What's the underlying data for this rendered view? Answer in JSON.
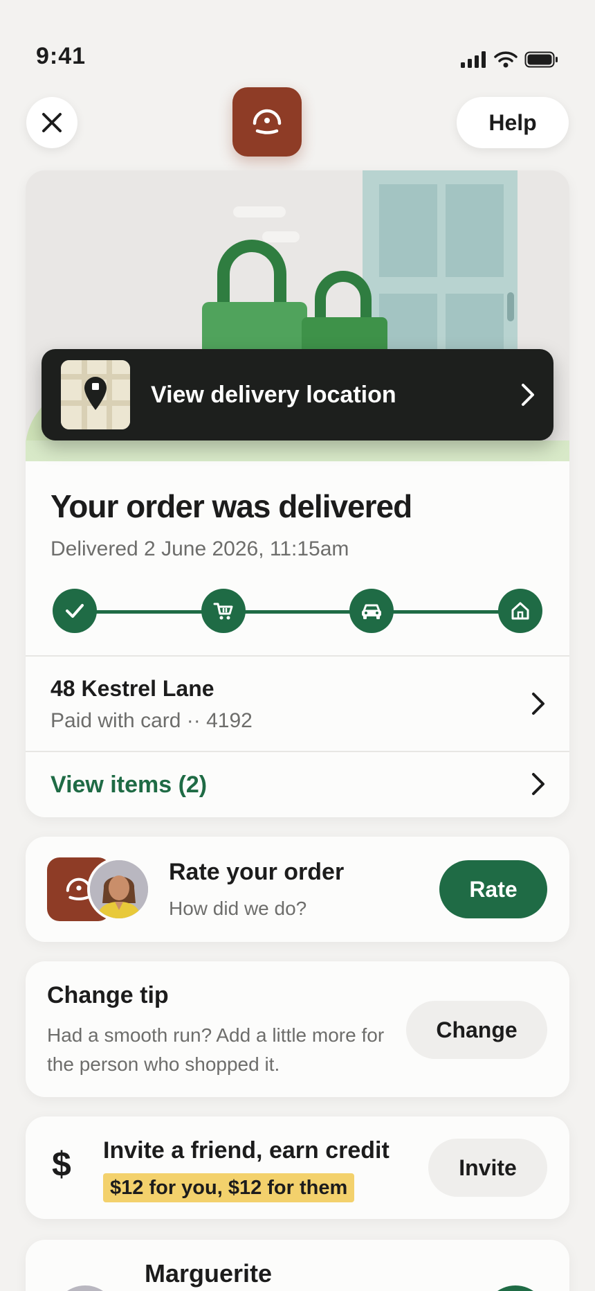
{
  "status_bar": {
    "time": "9:41"
  },
  "header": {
    "help_label": "Help"
  },
  "location_button": {
    "label": "View delivery location"
  },
  "order": {
    "title": "Your order was delivered",
    "delivered_time": "Delivered 2 June 2026, 11:15am",
    "steps": [
      "check-icon",
      "cart-icon",
      "car-icon",
      "home-icon"
    ],
    "address": "48 Kestrel Lane",
    "payment": "Paid with card ·· 4192",
    "view_items": "View items (2)"
  },
  "rate": {
    "title": "Rate your order",
    "subtitle": "How did we do?",
    "button": "Rate"
  },
  "tip": {
    "title": "Change tip",
    "subtitle": "Had a smooth run? Add a little more for the person who shopped it.",
    "button": "Change"
  },
  "invite": {
    "icon": "$",
    "title": "Invite a friend, earn credit",
    "promo": "$12 for you, $12 for them",
    "button": "Invite"
  },
  "shopper": {
    "name": "Marguerite"
  },
  "colors": {
    "brand": "#8e3c26",
    "accent_green": "#1f6b45",
    "highlight": "#f3d16c"
  }
}
